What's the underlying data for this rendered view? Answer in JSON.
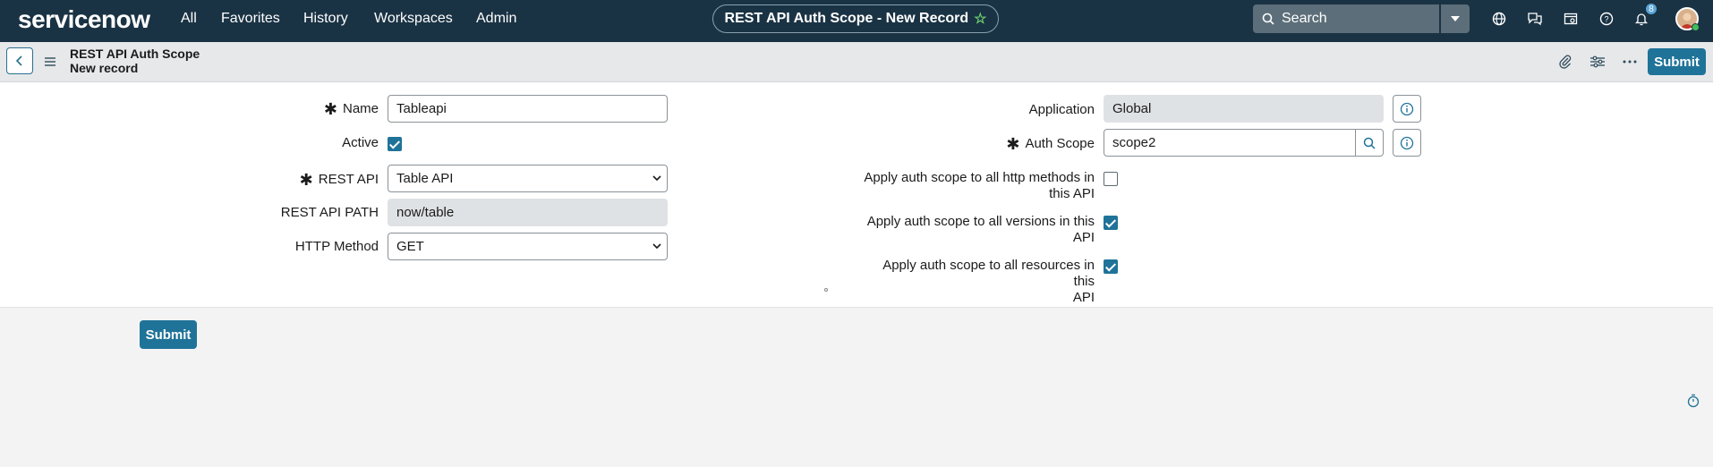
{
  "topbar": {
    "logo": "servicenow",
    "nav": [
      "All",
      "Favorites",
      "History",
      "Workspaces",
      "Admin"
    ],
    "page_title": "REST API Auth Scope - New Record",
    "search_placeholder": "Search",
    "notification_count": "8"
  },
  "header": {
    "title": "REST API Auth Scope",
    "subtitle": "New record",
    "submit_label": "Submit"
  },
  "form": {
    "name_label": "Name",
    "name_value": "Tableapi",
    "active_label": "Active",
    "active_checked": true,
    "rest_api_label": "REST API",
    "rest_api_value": "Table API",
    "rest_api_path_label": "REST API PATH",
    "rest_api_path_value": "now/table",
    "http_method_label": "HTTP Method",
    "http_method_value": "GET",
    "application_label": "Application",
    "application_value": "Global",
    "auth_scope_label": "Auth Scope",
    "auth_scope_value": "scope2",
    "apply_http_line1": "Apply auth scope to all http methods in",
    "apply_http_line2": "this API",
    "apply_http_checked": false,
    "apply_versions_line1": "Apply auth scope to all versions in this",
    "apply_versions_line2": "API",
    "apply_versions_checked": true,
    "apply_resources_line1": "Apply auth scope to all resources in this",
    "apply_resources_line2": "API",
    "apply_resources_checked": true
  },
  "footer": {
    "submit_label": "Submit"
  },
  "colors": {
    "topbar": "#1a3344",
    "accent": "#1f7399"
  }
}
